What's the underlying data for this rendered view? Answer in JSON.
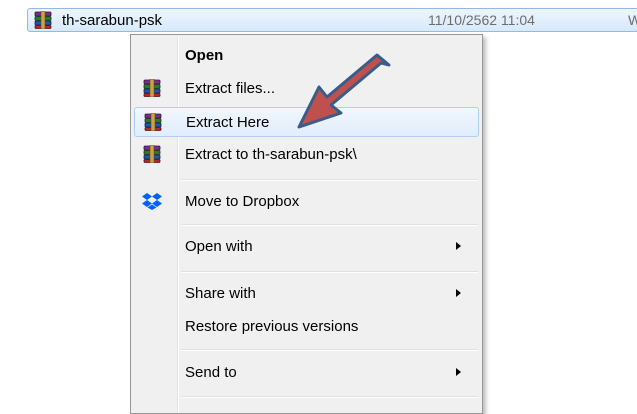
{
  "file": {
    "name": "th-sarabun-psk",
    "modified": "11/10/2562 11:04",
    "type_partial": "Wi"
  },
  "menu": {
    "open": "Open",
    "extract_files": "Extract files...",
    "extract_here": "Extract Here",
    "extract_to": "Extract to th-sarabun-psk\\",
    "move_to_dropbox": "Move to Dropbox",
    "open_with": "Open with",
    "share_with": "Share with",
    "restore_previous": "Restore previous versions",
    "send_to": "Send to"
  },
  "icons": {
    "archive": "winrar-archive-icon",
    "dropbox": "dropbox-icon",
    "submenu": "submenu-arrow-icon",
    "pointer": "red-arrow-pointer"
  },
  "colors": {
    "arrow_fill": "#c0504d",
    "arrow_stroke": "#385d8a",
    "selection": "#d6e9fc",
    "dropbox_blue": "#0061fe"
  }
}
